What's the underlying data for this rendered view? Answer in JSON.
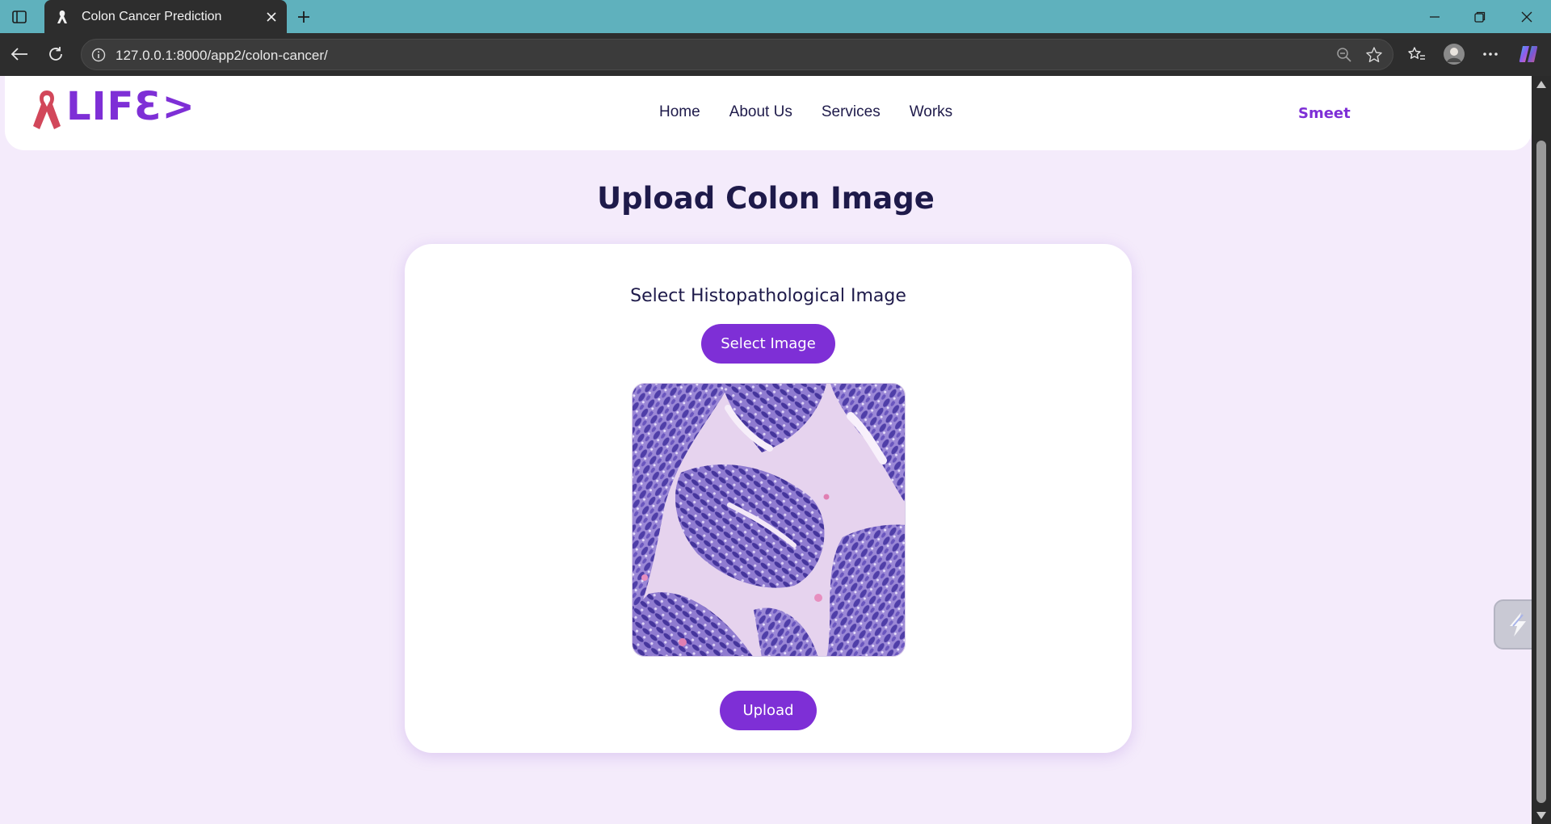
{
  "browser": {
    "tab_title": "Colon Cancer Prediction",
    "url": "127.0.0.1:8000/app2/colon-cancer/"
  },
  "navbar": {
    "logo_text": "LIFƐ>",
    "links": [
      {
        "label": "Home"
      },
      {
        "label": "About Us"
      },
      {
        "label": "Services"
      },
      {
        "label": "Works"
      }
    ],
    "user_name": "Smeet"
  },
  "page": {
    "title": "Upload Colon Image",
    "select_label": "Select Histopathological Image",
    "select_button": "Select Image",
    "upload_button": "Upload"
  },
  "colors": {
    "brand_purple": "#7e2fd6",
    "page_background": "#f4ebfb",
    "heading_text": "#1e1a4a",
    "ribbon_red": "#d2475a",
    "tab_bar": "#5fb1bd"
  }
}
